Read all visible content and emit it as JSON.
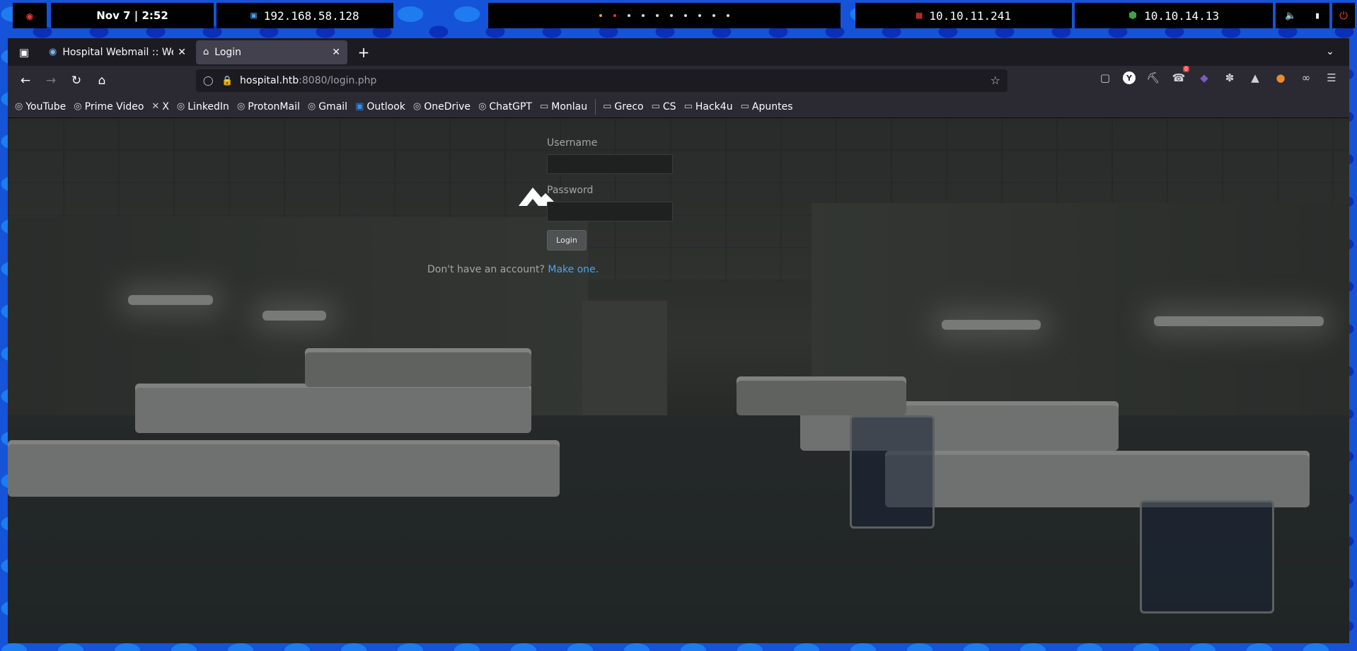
{
  "system_bar": {
    "date_time": "Nov 7 | 2:52",
    "vm_ip": "192.168.58.128",
    "target_ip": "10.10.11.241",
    "vpn_ip": "10.10.14.13",
    "workspace_dots": [
      "orange",
      "red",
      "white",
      "white",
      "white",
      "white",
      "white",
      "white",
      "white",
      "white"
    ]
  },
  "tabs": [
    {
      "title": "Hospital Webmail :: Welcome",
      "icon": "webmail-icon",
      "active": false
    },
    {
      "title": "Login",
      "icon": "home-icon",
      "active": true
    }
  ],
  "url": {
    "host": "hospital.htb",
    "path": ":8080/login.php"
  },
  "bookmarks": [
    {
      "label": "YouTube",
      "icon": "globe-icon"
    },
    {
      "label": "Prime Video",
      "icon": "globe-icon"
    },
    {
      "label": "X",
      "icon": "x-icon"
    },
    {
      "label": "LinkedIn",
      "icon": "globe-icon"
    },
    {
      "label": "ProtonMail",
      "icon": "globe-icon"
    },
    {
      "label": "Gmail",
      "icon": "globe-icon"
    },
    {
      "label": "Outlook",
      "icon": "outlook-icon"
    },
    {
      "label": "OneDrive",
      "icon": "globe-icon"
    },
    {
      "label": "ChatGPT",
      "icon": "globe-icon"
    },
    {
      "label": "Monlau",
      "icon": "folder-icon"
    }
  ],
  "bookmark_folders": [
    {
      "label": "Greco",
      "icon": "folder-icon"
    },
    {
      "label": "CS",
      "icon": "folder-icon"
    },
    {
      "label": "Hack4u",
      "icon": "folder-icon"
    },
    {
      "label": "Apuntes",
      "icon": "folder-icon"
    }
  ],
  "extensions": {
    "badge_count": "0"
  },
  "login": {
    "username_label": "Username",
    "username_value": "",
    "password_label": "Password",
    "password_value": "",
    "button_label": "Login",
    "signup_text": "Don't have an account?",
    "signup_link": "Make one."
  },
  "colors": {
    "link": "#4aa3ee",
    "sys_bar_bg": "#000000",
    "accent_red": "#e53935",
    "accent_green": "#43a047"
  }
}
